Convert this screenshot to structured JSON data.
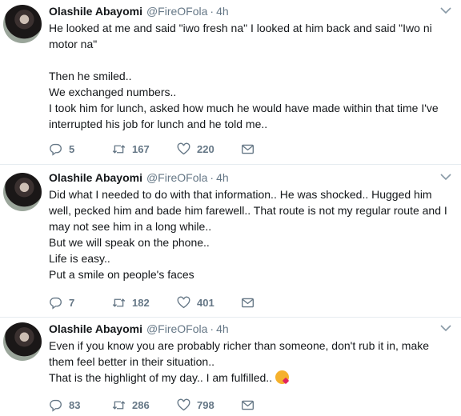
{
  "tweets": [
    {
      "name": "Olashile Abayomi",
      "handle": "@FireOFola",
      "time": "4h",
      "lines": [
        "He looked at me and said \"iwo fresh na\" I looked at him back and said \"Iwo ni",
        "motor na\"",
        "",
        "Then he smiled..",
        "We exchanged numbers..",
        "I took him for lunch,  asked how much he would have made within that time I've",
        "interrupted his job for lunch and he told me.."
      ],
      "replies": "5",
      "retweets": "167",
      "likes": "220"
    },
    {
      "name": "Olashile Abayomi",
      "handle": "@FireOFola",
      "time": "4h",
      "lines": [
        "Did what I needed to do with that information.. He was shocked..  Hugged him",
        "well, pecked him and bade him farewell..  That route is not my regular route and I",
        "may not see him in a long while..",
        "But we will speak on the phone..",
        "Life is easy..",
        "Put a smile on people's faces"
      ],
      "replies": "7",
      "retweets": "182",
      "likes": "401"
    },
    {
      "name": "Olashile Abayomi",
      "handle": "@FireOFola",
      "time": "4h",
      "lines": [
        "Even if you know you are probably richer than someone,  don't rub it in,  make",
        "them feel better in their situation..",
        "That is the highlight of my day..  I am fulfilled.."
      ],
      "replies": "83",
      "retweets": "286",
      "likes": "798"
    }
  ],
  "icons": {
    "reply": "reply-icon",
    "retweet": "retweet-icon",
    "like": "heart-icon",
    "dm": "envelope-icon",
    "caret": "chevron-down-icon",
    "emoji": "face-blowing-kiss-emoji"
  }
}
